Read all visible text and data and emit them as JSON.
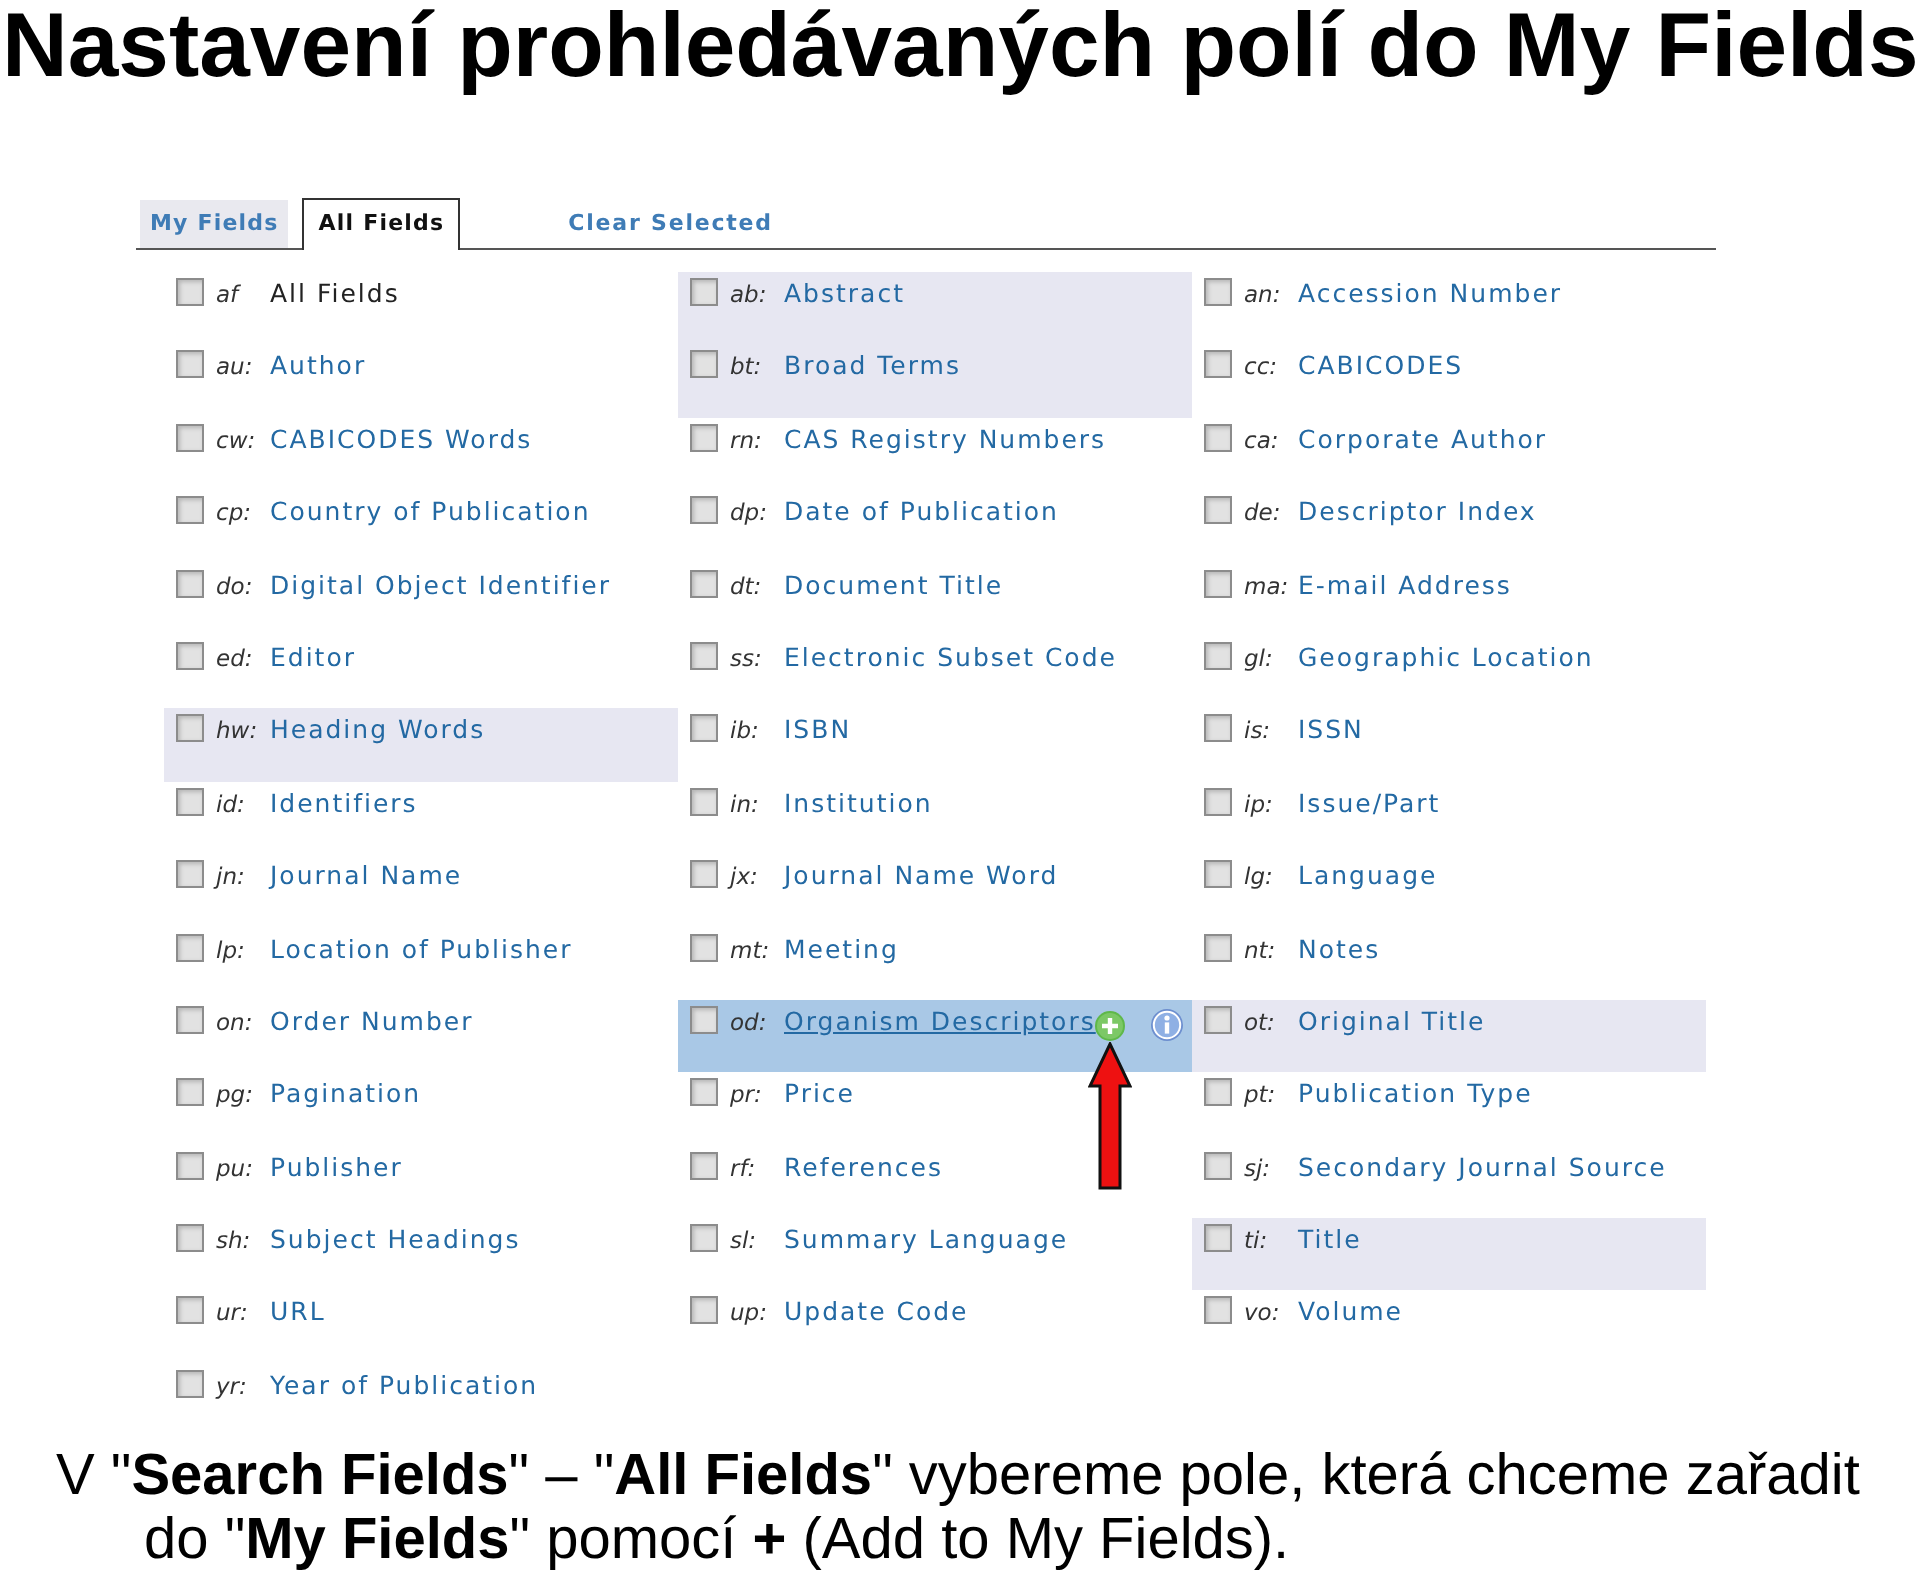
{
  "title": "Nastavení prohledávaných polí do My Fields",
  "panel": {
    "tabs": [
      {
        "label": "My Fields",
        "selected": false
      },
      {
        "label": "All Fields",
        "selected": true
      }
    ],
    "clear_link": "Clear Selected",
    "columns": [
      {
        "fields": [
          {
            "code": "af",
            "label": "All Fields",
            "kind": "plain",
            "checked": false,
            "shaded": false,
            "hovered": false
          },
          {
            "code": "au:",
            "label": "Author",
            "kind": "link",
            "checked": false,
            "shaded": false,
            "hovered": false
          },
          {
            "code": "cw:",
            "label": "CABICODES Words",
            "kind": "link",
            "checked": false,
            "shaded": false,
            "hovered": false
          },
          {
            "code": "cp:",
            "label": "Country of Publication",
            "kind": "link",
            "checked": false,
            "shaded": false,
            "hovered": false
          },
          {
            "code": "do:",
            "label": "Digital Object Identifier",
            "kind": "link",
            "checked": false,
            "shaded": false,
            "hovered": false
          },
          {
            "code": "ed:",
            "label": "Editor",
            "kind": "link",
            "checked": false,
            "shaded": false,
            "hovered": false
          },
          {
            "code": "hw:",
            "label": "Heading Words",
            "kind": "link",
            "checked": false,
            "shaded": true,
            "hovered": false
          },
          {
            "code": "id:",
            "label": "Identifiers",
            "kind": "link",
            "checked": false,
            "shaded": false,
            "hovered": false
          },
          {
            "code": "jn:",
            "label": "Journal Name",
            "kind": "link",
            "checked": false,
            "shaded": false,
            "hovered": false
          },
          {
            "code": "lp:",
            "label": "Location of Publisher",
            "kind": "link",
            "checked": false,
            "shaded": false,
            "hovered": false
          },
          {
            "code": "on:",
            "label": "Order Number",
            "kind": "link",
            "checked": false,
            "shaded": false,
            "hovered": false
          },
          {
            "code": "pg:",
            "label": "Pagination",
            "kind": "link",
            "checked": false,
            "shaded": false,
            "hovered": false
          },
          {
            "code": "pu:",
            "label": "Publisher",
            "kind": "link",
            "checked": false,
            "shaded": false,
            "hovered": false
          },
          {
            "code": "sh:",
            "label": "Subject Headings",
            "kind": "link",
            "checked": false,
            "shaded": false,
            "hovered": false
          },
          {
            "code": "ur:",
            "label": "URL",
            "kind": "link",
            "checked": false,
            "shaded": false,
            "hovered": false
          },
          {
            "code": "yr:",
            "label": "Year of Publication",
            "kind": "link",
            "checked": false,
            "shaded": false,
            "hovered": false
          }
        ]
      },
      {
        "fields": [
          {
            "code": "ab:",
            "label": "Abstract",
            "kind": "link",
            "checked": false,
            "shaded": true,
            "hovered": false
          },
          {
            "code": "bt:",
            "label": "Broad Terms",
            "kind": "link",
            "checked": false,
            "shaded": true,
            "hovered": false
          },
          {
            "code": "rn:",
            "label": "CAS Registry Numbers",
            "kind": "link",
            "checked": false,
            "shaded": false,
            "hovered": false
          },
          {
            "code": "dp:",
            "label": "Date of Publication",
            "kind": "link",
            "checked": false,
            "shaded": false,
            "hovered": false
          },
          {
            "code": "dt:",
            "label": "Document Title",
            "kind": "link",
            "checked": false,
            "shaded": false,
            "hovered": false
          },
          {
            "code": "ss:",
            "label": "Electronic Subset Code",
            "kind": "link",
            "checked": false,
            "shaded": false,
            "hovered": false
          },
          {
            "code": "ib:",
            "label": "ISBN",
            "kind": "link",
            "checked": false,
            "shaded": false,
            "hovered": false
          },
          {
            "code": "in:",
            "label": "Institution",
            "kind": "link",
            "checked": false,
            "shaded": false,
            "hovered": false
          },
          {
            "code": "jx:",
            "label": "Journal Name Word",
            "kind": "link",
            "checked": false,
            "shaded": false,
            "hovered": false
          },
          {
            "code": "mt:",
            "label": "Meeting",
            "kind": "link",
            "checked": false,
            "shaded": false,
            "hovered": false
          },
          {
            "code": "od:",
            "label": "Organism Descriptors",
            "kind": "link",
            "checked": false,
            "shaded": false,
            "hovered": true
          },
          {
            "code": "pr:",
            "label": "Price",
            "kind": "link",
            "checked": false,
            "shaded": false,
            "hovered": false
          },
          {
            "code": "rf:",
            "label": "References",
            "kind": "link",
            "checked": false,
            "shaded": false,
            "hovered": false
          },
          {
            "code": "sl:",
            "label": "Summary Language",
            "kind": "link",
            "checked": false,
            "shaded": false,
            "hovered": false
          },
          {
            "code": "up:",
            "label": "Update Code",
            "kind": "link",
            "checked": false,
            "shaded": false,
            "hovered": false
          }
        ]
      },
      {
        "fields": [
          {
            "code": "an:",
            "label": "Accession Number",
            "kind": "link",
            "checked": false,
            "shaded": false,
            "hovered": false
          },
          {
            "code": "cc:",
            "label": "CABICODES",
            "kind": "link",
            "checked": false,
            "shaded": false,
            "hovered": false
          },
          {
            "code": "ca:",
            "label": "Corporate Author",
            "kind": "link",
            "checked": false,
            "shaded": false,
            "hovered": false
          },
          {
            "code": "de:",
            "label": "Descriptor Index",
            "kind": "link",
            "checked": false,
            "shaded": false,
            "hovered": false
          },
          {
            "code": "ma:",
            "label": "E-mail Address",
            "kind": "link",
            "checked": false,
            "shaded": false,
            "hovered": false
          },
          {
            "code": "gl:",
            "label": "Geographic Location",
            "kind": "link",
            "checked": false,
            "shaded": false,
            "hovered": false
          },
          {
            "code": "is:",
            "label": "ISSN",
            "kind": "link",
            "checked": false,
            "shaded": false,
            "hovered": false
          },
          {
            "code": "ip:",
            "label": "Issue/Part",
            "kind": "link",
            "checked": false,
            "shaded": false,
            "hovered": false
          },
          {
            "code": "lg:",
            "label": "Language",
            "kind": "link",
            "checked": false,
            "shaded": false,
            "hovered": false
          },
          {
            "code": "nt:",
            "label": "Notes",
            "kind": "link",
            "checked": false,
            "shaded": false,
            "hovered": false
          },
          {
            "code": "ot:",
            "label": "Original Title",
            "kind": "link",
            "checked": false,
            "shaded": true,
            "hovered": false
          },
          {
            "code": "pt:",
            "label": "Publication Type",
            "kind": "link",
            "checked": false,
            "shaded": false,
            "hovered": false
          },
          {
            "code": "sj:",
            "label": "Secondary Journal Source",
            "kind": "link",
            "checked": false,
            "shaded": false,
            "hovered": false
          },
          {
            "code": "ti:",
            "label": "Title",
            "kind": "link",
            "checked": false,
            "shaded": true,
            "hovered": false
          },
          {
            "code": "vo:",
            "label": "Volume",
            "kind": "link",
            "checked": false,
            "shaded": false,
            "hovered": false
          }
        ]
      }
    ]
  },
  "caption": "V \"**Search Fields**\" – \"**All Fields**\" vybereme pole, která chceme zařadit do \"**My Fields**\" pomocí **+** (Add to My Fields)."
}
